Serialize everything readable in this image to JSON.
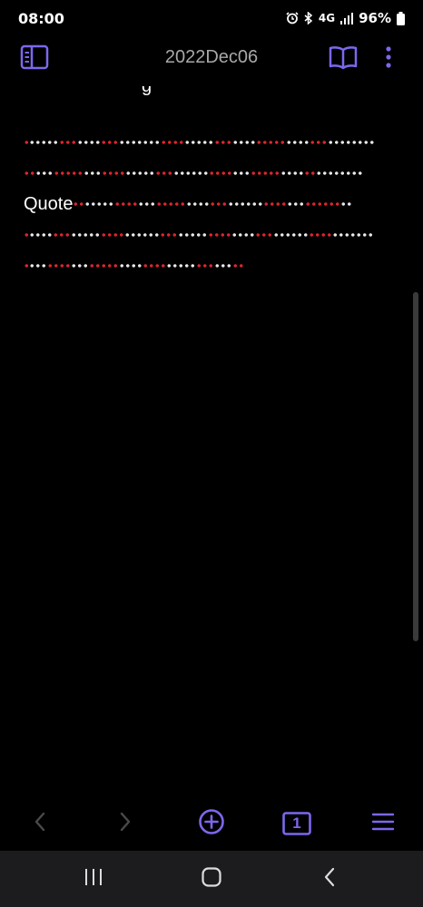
{
  "status_bar": {
    "time": "08:00",
    "network": "4G",
    "battery": "96%",
    "icons": [
      "alarm-icon",
      "bluetooth-icon",
      "network-4g-icon",
      "signal-icon",
      "battery-icon"
    ]
  },
  "header": {
    "title": "2022Dec06",
    "icons": [
      "sidebar-toggle-icon",
      "reading-mode-icon",
      "more-vertical-icon"
    ]
  },
  "note": {
    "quote_word": "Quote"
  },
  "toolbar": {
    "icons": [
      "chevron-left-icon",
      "chevron-right-icon",
      "new-note-icon",
      "tab-count-icon",
      "menu-icon"
    ],
    "tab_count": "1"
  },
  "system_nav": {
    "icons": [
      "recent-apps-icon",
      "home-icon",
      "back-icon"
    ]
  },
  "colors": {
    "background": "#000000",
    "accent": "#7b68ee",
    "title_text": "#a8a8a8",
    "dot_red": "#e0242c",
    "dot_white": "#e8e8e8",
    "system_nav_bg": "#1c1c1e"
  }
}
